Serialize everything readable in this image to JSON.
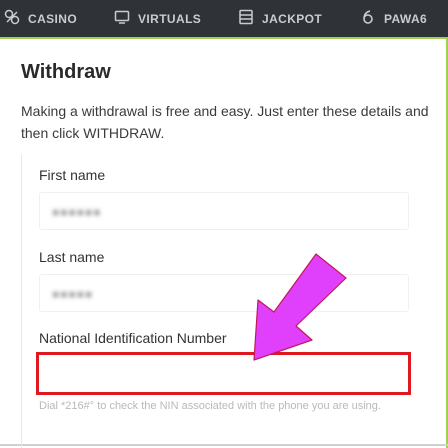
{
  "nav": {
    "items": [
      {
        "label": "CASINO",
        "icon": "casino-icon"
      },
      {
        "label": "VIRTUALS",
        "icon": "virtuals-icon"
      },
      {
        "label": "JACKPOT",
        "icon": "jackpot-icon"
      },
      {
        "label": "PAWA6",
        "icon": "pawa6-icon"
      }
    ]
  },
  "page": {
    "title": "Withdraw",
    "intro": "Making a withdrawal is free and easy. Just enter these details and then click WITHDRAW."
  },
  "form": {
    "first_name_label": "First name",
    "first_name_value": "●●●●●●",
    "last_name_label": "Last name",
    "last_name_value": "●●●●●",
    "nin_label": "National Identification Number",
    "nin_value": "",
    "hint": "Dial *216#° to check the NIN associated with the phone you are using."
  },
  "colors": {
    "nav_bg": "#2f3337",
    "accent_green": "#9fd150",
    "highlight_red": "#e0181f",
    "arrow_magenta": "#e040fb"
  }
}
